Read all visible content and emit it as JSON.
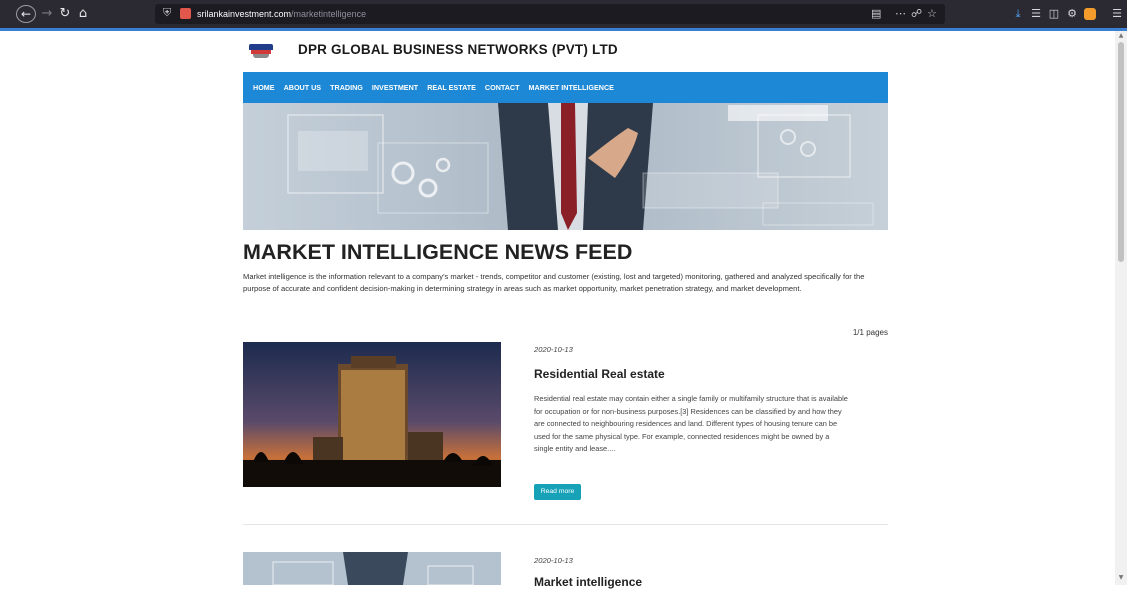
{
  "browser": {
    "url_domain": "srilankainvestment.com",
    "url_path": "/marketintelligence"
  },
  "site": {
    "name": "DPR GLOBAL BUSINESS NETWORKS (PVT) LTD"
  },
  "nav": {
    "items": [
      {
        "label": "HOME"
      },
      {
        "label": "ABOUT US"
      },
      {
        "label": "TRADING"
      },
      {
        "label": "INVESTMENT"
      },
      {
        "label": "REAL ESTATE"
      },
      {
        "label": "CONTACT"
      },
      {
        "label": "MARKET INTELLIGENCE"
      }
    ]
  },
  "main": {
    "headline": "MARKET INTELLIGENCE NEWS FEED",
    "intro": "Market intelligence is the information relevant to a company's market - trends, competitor and customer (existing, lost and targeted) monitoring, gathered and analyzed specifically for the purpose of accurate and confident decision-making in determining strategy in areas such as market opportunity, market penetration strategy, and market development.",
    "pages": "1/1 pages"
  },
  "posts": [
    {
      "date": "2020-10-13",
      "title": "Residential Real estate",
      "body": "Residential real estate may contain either a single family or multifamily structure that is available for occupation or for non-business purposes.[3] Residences can be classified by and how they are connected to neighbouring residences and land. Different types of housing tenure can be used for the same physical type. For example, connected residences might be owned by a single entity and lease....",
      "read_more": "Read more"
    },
    {
      "date": "2020-10-13",
      "title": "Market intelligence"
    }
  ],
  "colors": {
    "nav_bg": "#1d88d6",
    "button_bg": "#17a2b8"
  }
}
